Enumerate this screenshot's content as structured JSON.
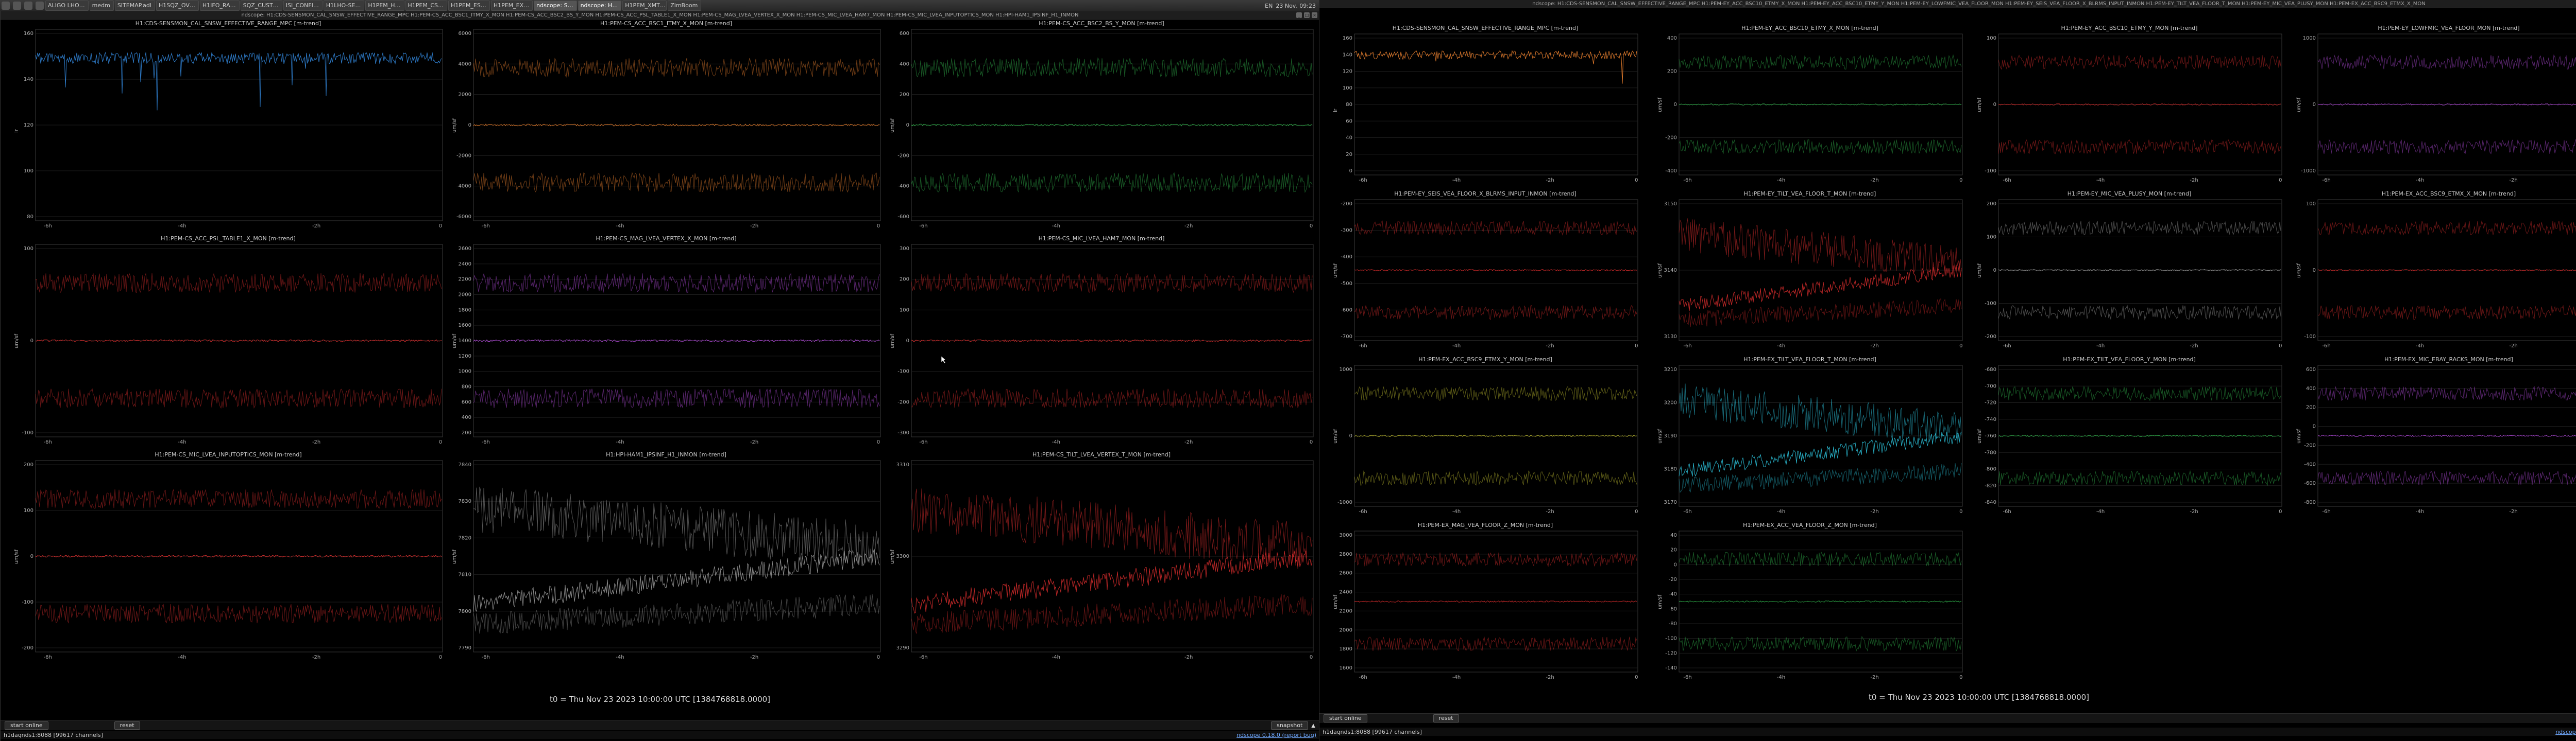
{
  "colors": {
    "series_blue": "#2f7fd0",
    "series_orange": "#e07a2b",
    "series_green": "#2fae4a",
    "series_red": "#d22b2b",
    "series_purple": "#b04ad8",
    "series_cyan": "#2bc0d8",
    "series_olive": "#b7b52e",
    "series_grey": "#9a9a9a"
  },
  "taskbar": {
    "tasks": [
      "ALIGO LHO…",
      "medm",
      "SITEMAP.adl",
      "H1SQZ_OV…",
      "H1IFO_RA…",
      "SQZ_CUST…",
      "ISI_CONFI…",
      "H1LHO-SE…",
      "H1PEM_H…",
      "H1PEM_CS…",
      "H1PEM_ES…",
      "H1PEM_EX…",
      "ndscope: S…",
      "ndscope: H…",
      "H1PEM_XMT…",
      "ZimBoom"
    ],
    "lang": "EN",
    "clock": "23 Nov, 09:23"
  },
  "left_window": {
    "title": "ndscope: H1:CDS-SENSMON_CAL_SNSW_EFFECTIVE_RANGE_MPC H1:PEM-CS_ACC_BSC1_ITMY_X_MON H1:PEM-CS_ACC_BSC2_BS_Y_MON H1:PEM-CS_ACC_PSL_TABLE1_X_MON H1:PEM-CS_MAG_LVEA_VERTEX_X_MON H1:PEM-CS_MIC_LVEA_HAM7_MON H1:PEM-CS_MIC_LVEA_INPUTOPTICS_MON H1:HPI-HAM1_IPSINF_H1_INMON",
    "t0": "t0 = Thu Nov 23 2023 10:00:00 UTC [1384768818.0000]",
    "controls": {
      "start": "start online",
      "reset": "reset",
      "snapshot": "snapshot"
    },
    "status": {
      "left": "h1daqnds1:8088 [99617 channels]",
      "version": "ndscope 0.18.0 (report bug)"
    },
    "plots": [
      {
        "title": "H1:CDS-SENSMON_CAL_SNSW_EFFECTIVE_RANGE_MPC [m-trend]",
        "ylabel": "lr",
        "yticks": [
          "160",
          "140",
          "120",
          "100",
          "80"
        ],
        "xticks": [
          "-6h",
          "-4h",
          "-2h",
          "0"
        ]
      },
      {
        "title": "H1:PEM-CS_ACC_BSC1_ITMY_X_MON [m-trend]",
        "ylabel": "um/sf",
        "yticks": [
          "6000",
          "4000",
          "2000",
          "0",
          "-2000",
          "-4000",
          "-6000"
        ],
        "xticks": [
          "-6h",
          "-4h",
          "-2h",
          "0"
        ]
      },
      {
        "title": "H1:PEM-CS_ACC_BSC2_BS_Y_MON [m-trend]",
        "ylabel": "um/sf",
        "yticks": [
          "600",
          "400",
          "200",
          "0",
          "-200",
          "-400",
          "-600"
        ],
        "xticks": [
          "-6h",
          "-4h",
          "-2h",
          "0"
        ]
      },
      {
        "title": "H1:PEM-CS_ACC_PSL_TABLE1_X_MON [m-trend]",
        "ylabel": "um/sf",
        "yticks": [
          "100",
          "0",
          "-100"
        ],
        "xticks": [
          "-6h",
          "-4h",
          "-2h",
          "0"
        ]
      },
      {
        "title": "H1:PEM-CS_MAG_LVEA_VERTEX_X_MON [m-trend]",
        "ylabel": "um/sf",
        "yticks": [
          "2600",
          "2400",
          "2200",
          "2000",
          "1800",
          "1600",
          "1400",
          "1200",
          "1000",
          "800",
          "600",
          "400",
          "200"
        ],
        "xticks": [
          "-6h",
          "-4h",
          "-2h",
          "0"
        ]
      },
      {
        "title": "H1:PEM-CS_MIC_LVEA_HAM7_MON [m-trend]",
        "ylabel": "um/sf",
        "yticks": [
          "300",
          "200",
          "100",
          "0",
          "-100",
          "-200",
          "-300"
        ],
        "xticks": [
          "-6h",
          "-4h",
          "-2h",
          "0"
        ]
      },
      {
        "title": "H1:PEM-CS_MIC_LVEA_INPUTOPTICS_MON [m-trend]",
        "ylabel": "um/sf",
        "yticks": [
          "200",
          "100",
          "0",
          "-100",
          "-200"
        ],
        "xticks": [
          "-6h",
          "-4h",
          "-2h",
          "0"
        ]
      },
      {
        "title": "H1:HPI-HAM1_IPSINF_H1_INMON [m-trend]",
        "ylabel": "um/sf",
        "yticks": [
          "7840",
          "7830",
          "7820",
          "7810",
          "7800",
          "7790"
        ],
        "xticks": [
          "-6h",
          "-4h",
          "-2h",
          "0"
        ]
      },
      {
        "title": "H1:PEM-CS_TILT_LVEA_VERTEX_T_MON [m-trend]",
        "ylabel": "um/sf",
        "yticks": [
          "3310",
          "3300",
          "3290"
        ],
        "xticks": [
          "-6h",
          "-4h",
          "-2h",
          "0"
        ]
      }
    ]
  },
  "right_window": {
    "title": "ndscope: H1:CDS-SENSMON_CAL_SNSW_EFFECTIVE_RANGE_MPC H1:PEM-EY_ACC_BSC10_ETMY_X_MON H1:PEM-EY_ACC_BSC10_ETMY_Y_MON H1:PEM-EY_LOWFMIC_VEA_FLOOR_MON H1:PEM-EY_SEIS_VEA_FLOOR_X_BLRMS_INPUT_INMON H1:PEM-EY_TILT_VEA_FLOOR_T_MON H1:PEM-EY_MIC_VEA_PLUSY_MON H1:PEM-EX_ACC_BSC9_ETMX_X_MON",
    "t0": "t0 = Thu Nov 23 2023 10:00:00 UTC [1384768818.0000]",
    "controls": {
      "start": "start online",
      "reset": "reset",
      "snapshot": "snapshot"
    },
    "status": {
      "left": "h1daqnds1:8088 [99617 channels]",
      "version": "ndscope 0.18.0 (report bug)"
    },
    "plots": [
      {
        "title": "H1:CDS-SENSMON_CAL_SNSW_EFFECTIVE_RANGE_MPC [m-trend]",
        "ylabel": "lr",
        "yticks": [
          "160",
          "140",
          "120",
          "100",
          "80",
          "60",
          "40",
          "20",
          "0"
        ],
        "xticks": [
          "-6h",
          "-4h",
          "-2h",
          "0"
        ]
      },
      {
        "title": "H1:PEM-EY_ACC_BSC10_ETMY_X_MON [m-trend]",
        "ylabel": "um/sf",
        "yticks": [
          "400",
          "200",
          "0",
          "-200",
          "-400"
        ],
        "xticks": [
          "-6h",
          "-4h",
          "-2h",
          "0"
        ]
      },
      {
        "title": "H1:PEM-EY_ACC_BSC10_ETMY_Y_MON [m-trend]",
        "ylabel": "um/sf",
        "yticks": [
          "100",
          "0",
          "-100"
        ],
        "xticks": [
          "-6h",
          "-4h",
          "-2h",
          "0"
        ]
      },
      {
        "title": "H1:PEM-EY_LOWFMIC_VEA_FLOOR_MON [m-trend]",
        "ylabel": "um/sf",
        "yticks": [
          "1000",
          "0",
          "-1000"
        ],
        "xticks": [
          "-6h",
          "-4h",
          "-2h",
          "0"
        ]
      },
      {
        "title": "H1:PEM-EY_SEIS_VEA_FLOOR_X_BLRMS_INPUT_INMON [m-trend]",
        "ylabel": "um/sf",
        "yticks": [
          "-200",
          "-300",
          "-400",
          "-500",
          "-600",
          "-700"
        ],
        "xticks": [
          "-6h",
          "-4h",
          "-2h",
          "0"
        ]
      },
      {
        "title": "H1:PEM-EY_TILT_VEA_FLOOR_T_MON [m-trend]",
        "ylabel": "um/sf",
        "yticks": [
          "3150",
          "3140",
          "3130"
        ],
        "xticks": [
          "-6h",
          "-4h",
          "-2h",
          "0"
        ]
      },
      {
        "title": "H1:PEM-EY_MIC_VEA_PLUSY_MON [m-trend]",
        "ylabel": "um/sf",
        "yticks": [
          "200",
          "100",
          "0",
          "-100",
          "-200"
        ],
        "xticks": [
          "-6h",
          "-4h",
          "-2h",
          "0"
        ]
      },
      {
        "title": "H1:PEM-EX_ACC_BSC9_ETMX_X_MON [m-trend]",
        "ylabel": "um/sf",
        "yticks": [
          "100",
          "0",
          "-100"
        ],
        "xticks": [
          "-6h",
          "-4h",
          "-2h",
          "0"
        ]
      },
      {
        "title": "H1:PEM-EX_ACC_BSC9_ETMX_Y_MON [m-trend]",
        "ylabel": "um/sf",
        "yticks": [
          "1000",
          "0",
          "-1000"
        ],
        "xticks": [
          "-6h",
          "-4h",
          "-2h",
          "0"
        ]
      },
      {
        "title": "H1:PEM-EX_TILT_VEA_FLOOR_T_MON [m-trend]",
        "ylabel": "um/sf",
        "yticks": [
          "3210",
          "3200",
          "3190",
          "3180",
          "3170"
        ],
        "xticks": [
          "-6h",
          "-4h",
          "-2h",
          "0"
        ]
      },
      {
        "title": "H1:PEM-EX_TILT_VEA_FLOOR_Y_MON [m-trend]",
        "ylabel": "um/sf",
        "yticks": [
          "-680",
          "-700",
          "-720",
          "-740",
          "-760",
          "-780",
          "-800",
          "-820",
          "-840"
        ],
        "xticks": [
          "-6h",
          "-4h",
          "-2h",
          "0"
        ]
      },
      {
        "title": "H1:PEM-EX_MIC_EBAY_RACKS_MON [m-trend]",
        "ylabel": "um/sf",
        "yticks": [
          "600",
          "400",
          "200",
          "0",
          "-200",
          "-400",
          "-600",
          "-800"
        ],
        "xticks": [
          "-6h",
          "-4h",
          "-2h",
          "0"
        ]
      },
      {
        "title": "H1:PEM-EX_MAG_VEA_FLOOR_Z_MON [m-trend]",
        "ylabel": "um/sf",
        "yticks": [
          "3000",
          "2800",
          "2600",
          "2400",
          "2200",
          "2000",
          "1800",
          "1600"
        ],
        "xticks": [
          "-6h",
          "-4h",
          "-2h",
          "0"
        ]
      },
      {
        "title": "H1:PEM-EX_ACC_VEA_FLOOR_Z_MON [m-trend]",
        "ylabel": "um/sf",
        "yticks": [
          "40",
          "20",
          "0",
          "-20",
          "-40",
          "-60",
          "-80",
          "-100",
          "-120",
          "-140"
        ],
        "xticks": [
          "-6h",
          "-4h",
          "-2h",
          "0"
        ]
      }
    ]
  }
}
